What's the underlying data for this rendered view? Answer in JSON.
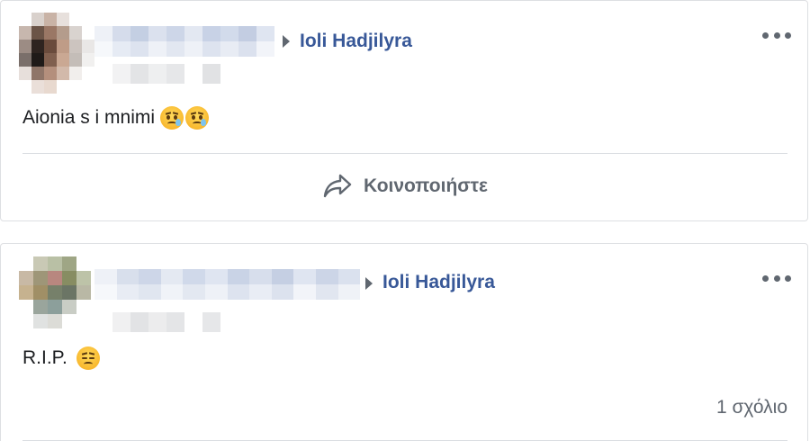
{
  "posts": [
    {
      "target_name": "Ioli Hadjilyra",
      "text": "Aionia s i mnimi",
      "emoji": [
        "disappointed-relieved-face-emoji",
        "disappointed-relieved-face-emoji"
      ],
      "share_label": "Κοινοποιήστε"
    },
    {
      "target_name": "Ioli Hadjilyra",
      "text": "R.I.P.",
      "emoji": [
        "pensive-face-emoji"
      ],
      "comment_count": "1 σχόλιο"
    }
  ],
  "colors": {
    "link": "#385898",
    "secondary_text": "#606770",
    "border": "#dddfe2"
  }
}
